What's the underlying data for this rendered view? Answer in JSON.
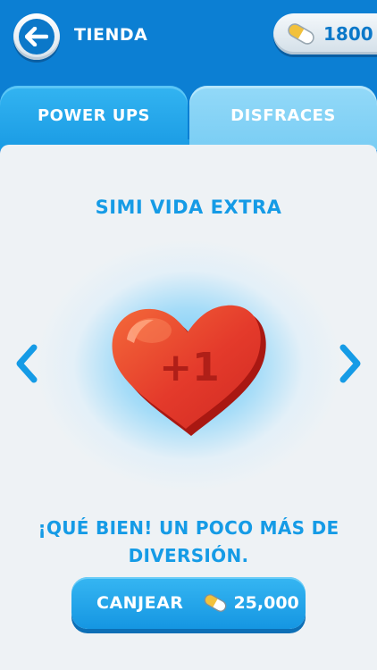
{
  "header": {
    "title": "TIENDA",
    "back_icon": "arrow-left-icon",
    "coins": "1800",
    "coin_icon": "pill-capsule-icon"
  },
  "tabs": [
    {
      "label": "POWER UPS",
      "active": true
    },
    {
      "label": "DISFRACES",
      "active": false
    }
  ],
  "item": {
    "title": "SIMI VIDA EXTRA",
    "image_label": "+1",
    "image_icon": "heart-icon",
    "description": "¡QUÉ BIEN! UN POCO MÁS DE DIVERSIÓN.",
    "prev_icon": "chevron-left-icon",
    "next_icon": "chevron-right-icon"
  },
  "redeem": {
    "label": "CANJEAR",
    "price": "25,000",
    "price_icon": "pill-capsule-icon"
  },
  "colors": {
    "primary_blue": "#0c7fd3",
    "accent_blue": "#159be6",
    "heart_red": "#e8392a",
    "panel_bg": "#eef2f5"
  }
}
